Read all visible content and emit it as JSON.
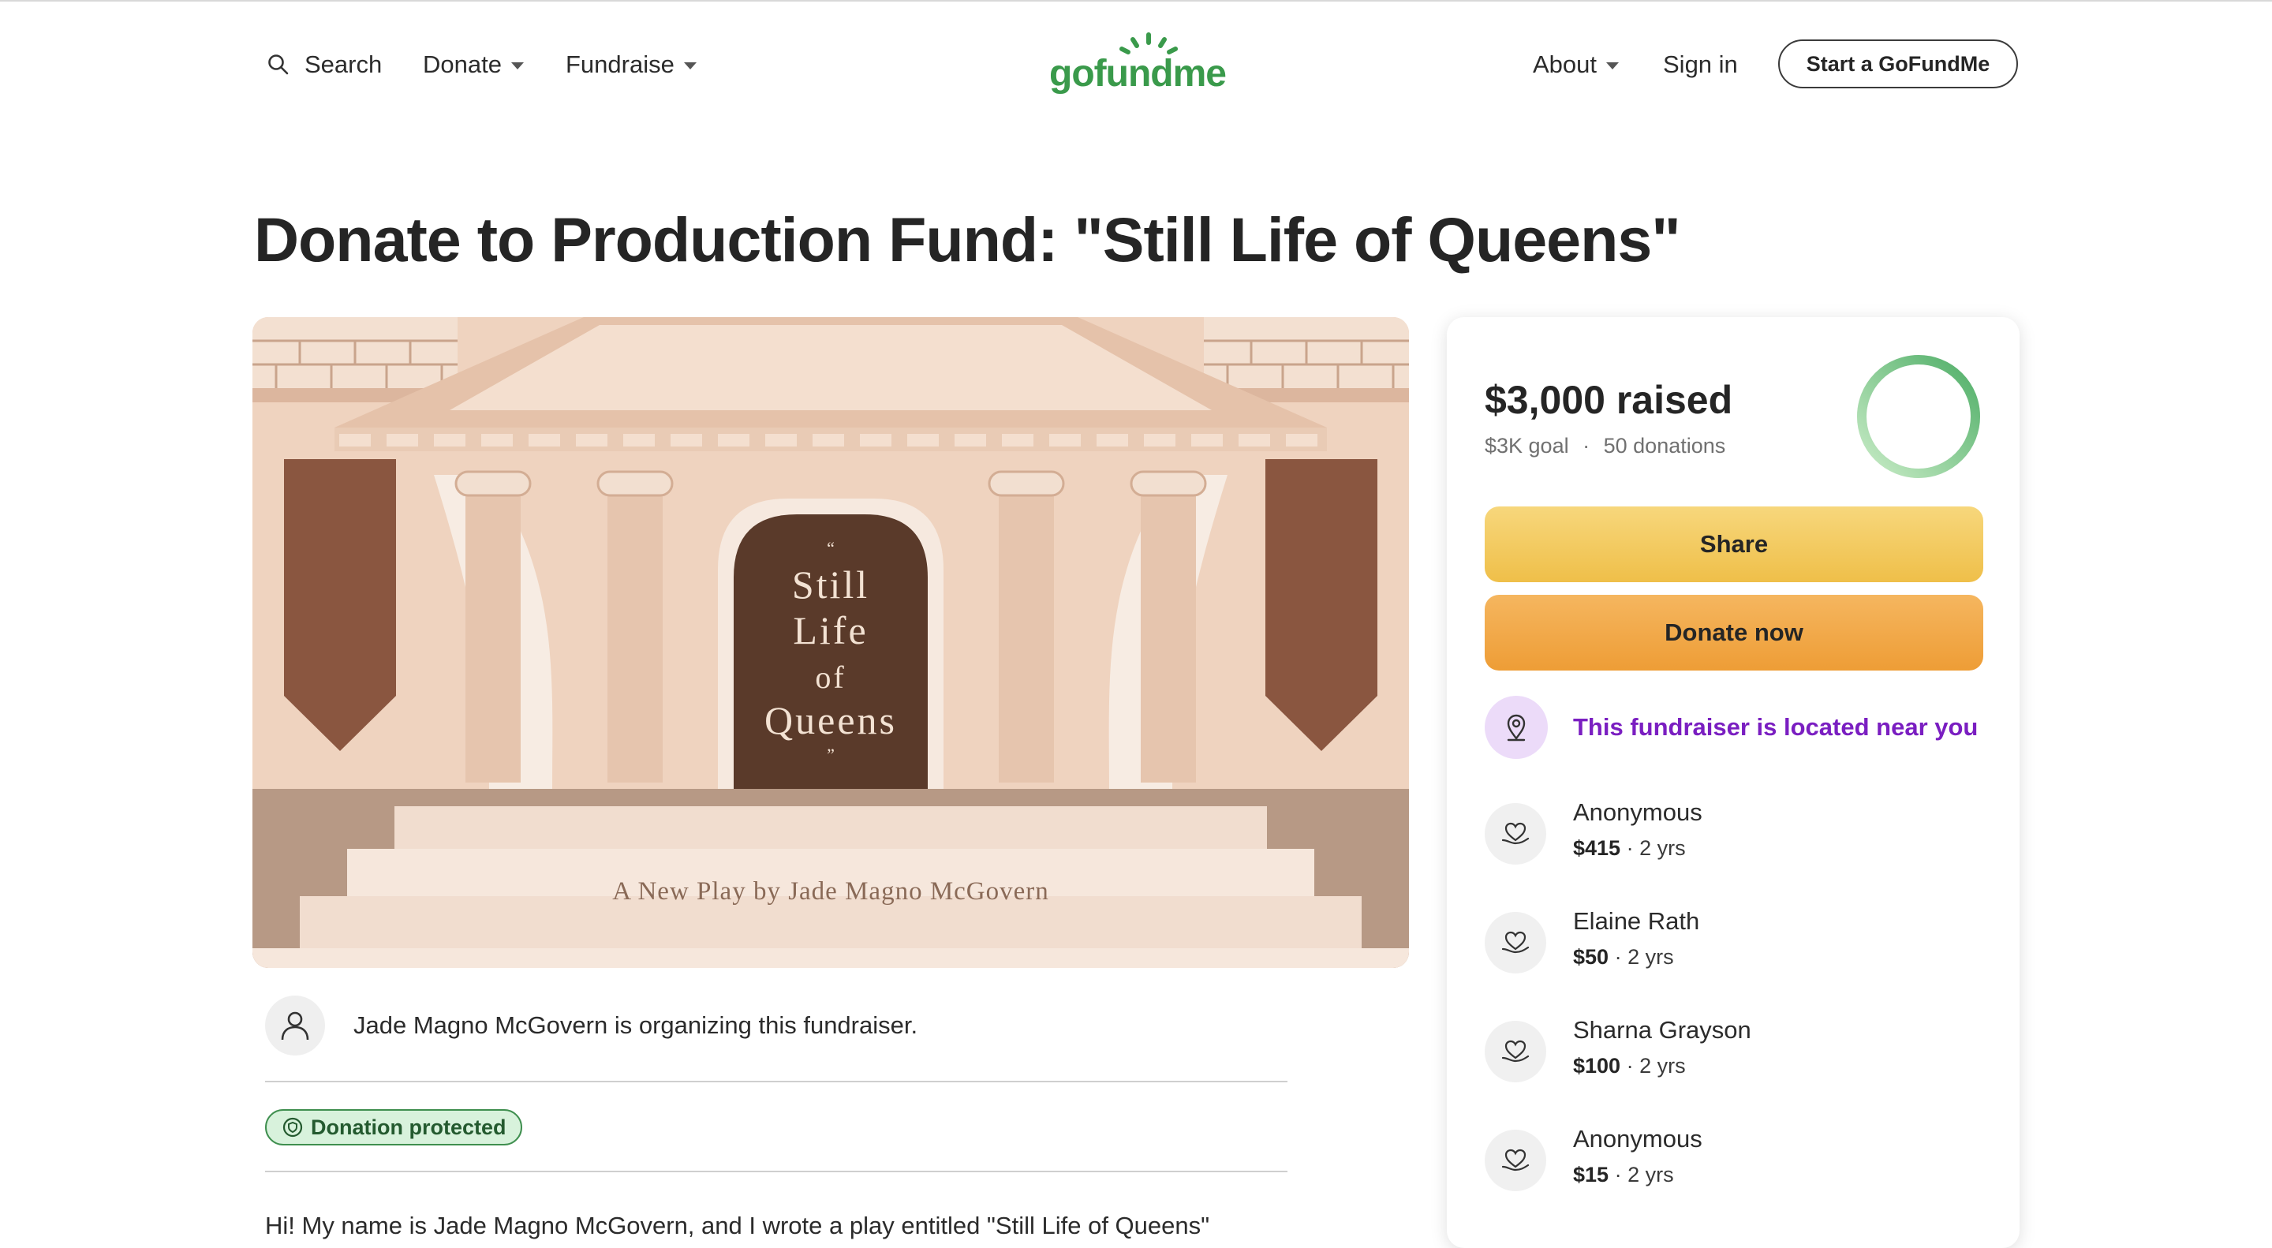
{
  "header": {
    "search_label": "Search",
    "donate_label": "Donate",
    "fundraise_label": "Fundraise",
    "logo_text": "gofundme",
    "about_label": "About",
    "signin_label": "Sign in",
    "start_label": "Start a GoFundMe",
    "brand_color": "#3a9a4b"
  },
  "page": {
    "title": "Donate to Production Fund: \"Still Life of Queens\""
  },
  "hero": {
    "quote_open": "“",
    "line1": "Still",
    "line2": "Life",
    "line3": "of",
    "line4": "Queens",
    "quote_close": "”",
    "byline": "A New Play by Jade Magno McGovern"
  },
  "organizer": {
    "text": "Jade Magno McGovern is organizing this fundraiser."
  },
  "badge": {
    "label": "Donation protected"
  },
  "story": {
    "text": "Hi! My name is Jade Magno McGovern, and I wrote a play entitled \"Still Life of Queens\""
  },
  "sidebar": {
    "raised": "$3,000 raised",
    "goal": "$3K goal",
    "separator": "·",
    "donations": "50 donations",
    "progress": 1.0,
    "share_label": "Share",
    "donate_label": "Donate now",
    "location_text": "This fundraiser is located near you",
    "donors": [
      {
        "name": "Anonymous",
        "amount": "$415",
        "time": "2 yrs"
      },
      {
        "name": "Elaine Rath",
        "amount": "$50",
        "time": "2 yrs"
      },
      {
        "name": "Sharna Grayson",
        "amount": "$100",
        "time": "2 yrs"
      },
      {
        "name": "Anonymous",
        "amount": "$15",
        "time": "2 yrs"
      }
    ],
    "donor_separator": "·"
  }
}
